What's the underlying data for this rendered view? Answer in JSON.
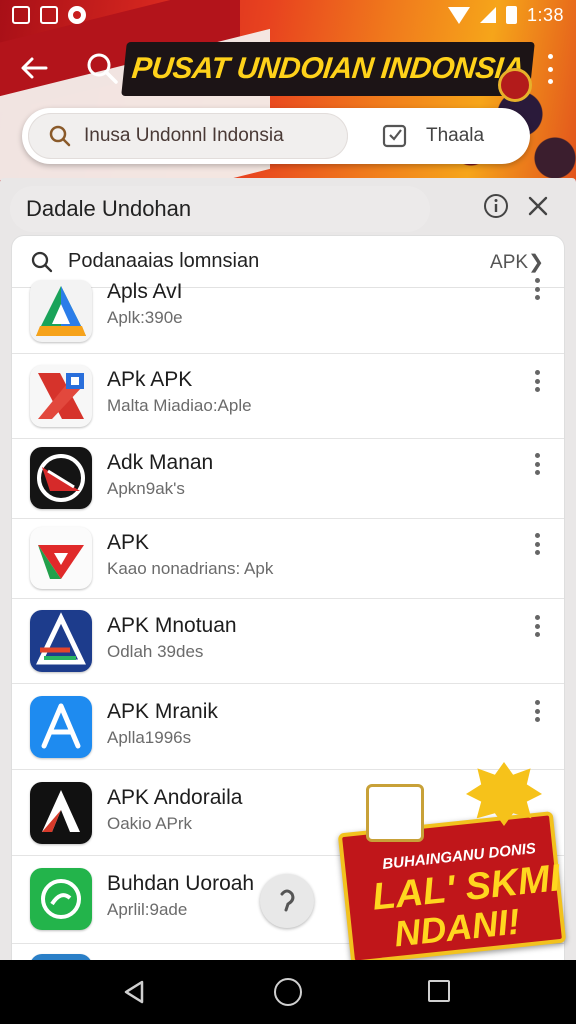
{
  "status_bar": {
    "time": "1:38"
  },
  "header": {
    "banner_title": "PUSAT UNDOIAN INDONSIA",
    "search_pill_text": "Inusa Undonnl Indonsia",
    "right_action_label": "Thaala"
  },
  "sheet": {
    "title": "Dadale Undohan",
    "search_text": "Podanaaias lomnsian",
    "apk_tag": "APK",
    "apps": [
      {
        "title": "Apls AvI",
        "subtitle": "Aplk:390e"
      },
      {
        "title": "APk APK",
        "subtitle": "Malta Miadiao:Aple"
      },
      {
        "title": "Adk Manan",
        "subtitle": "Apkn9ak's"
      },
      {
        "title": "APK",
        "subtitle": "Kaao nonadrians: Apk"
      },
      {
        "title": "APK Mnotuan",
        "subtitle": "Odlah 39des"
      },
      {
        "title": "APK Mranik",
        "subtitle": "Aplla1996s"
      },
      {
        "title": "APK Andoraila",
        "subtitle": "Oakio APrk"
      },
      {
        "title": "Buhdan Uoroah",
        "subtitle": "Aprlil:9ade"
      }
    ]
  },
  "promo": {
    "line1": "BUHAINGANU DONIS",
    "line2": "LAL' SKMI",
    "line3": "NDANI!"
  }
}
